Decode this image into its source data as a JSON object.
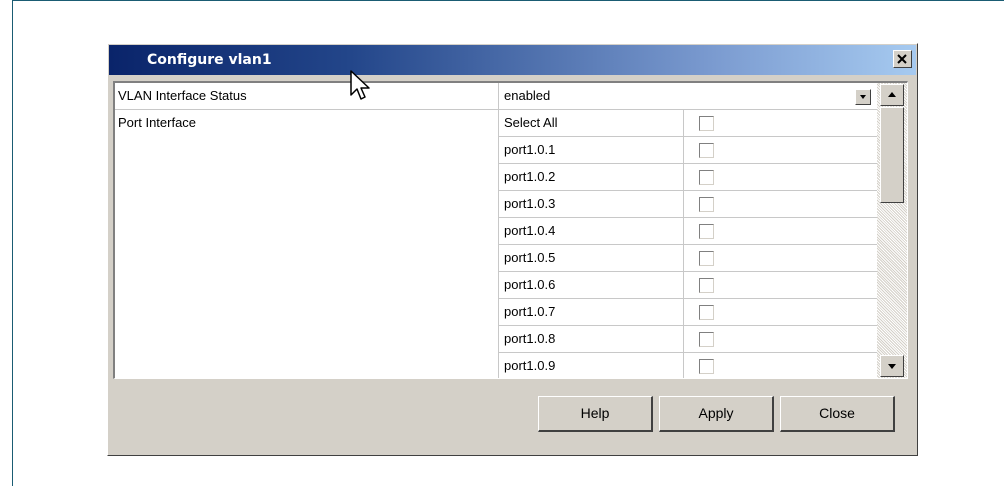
{
  "dialog": {
    "title": "Configure vlan1",
    "close_icon": "close-icon"
  },
  "status_row": {
    "label": "VLAN Interface Status",
    "value": "enabled",
    "dropdown_icon": "chevron-down-icon"
  },
  "port_section": {
    "label": "Port Interface",
    "items": [
      {
        "label": "Select All",
        "checked": false
      },
      {
        "label": "port1.0.1",
        "checked": false
      },
      {
        "label": "port1.0.2",
        "checked": false
      },
      {
        "label": "port1.0.3",
        "checked": false
      },
      {
        "label": "port1.0.4",
        "checked": false
      },
      {
        "label": "port1.0.5",
        "checked": false
      },
      {
        "label": "port1.0.6",
        "checked": false
      },
      {
        "label": "port1.0.7",
        "checked": false
      },
      {
        "label": "port1.0.8",
        "checked": false
      },
      {
        "label": "port1.0.9",
        "checked": false
      }
    ]
  },
  "scrollbar": {
    "up_icon": "scroll-up-icon",
    "down_icon": "scroll-down-icon"
  },
  "buttons": {
    "help": "Help",
    "apply": "Apply",
    "close": "Close"
  },
  "cursor_icon": "mouse-pointer-icon"
}
